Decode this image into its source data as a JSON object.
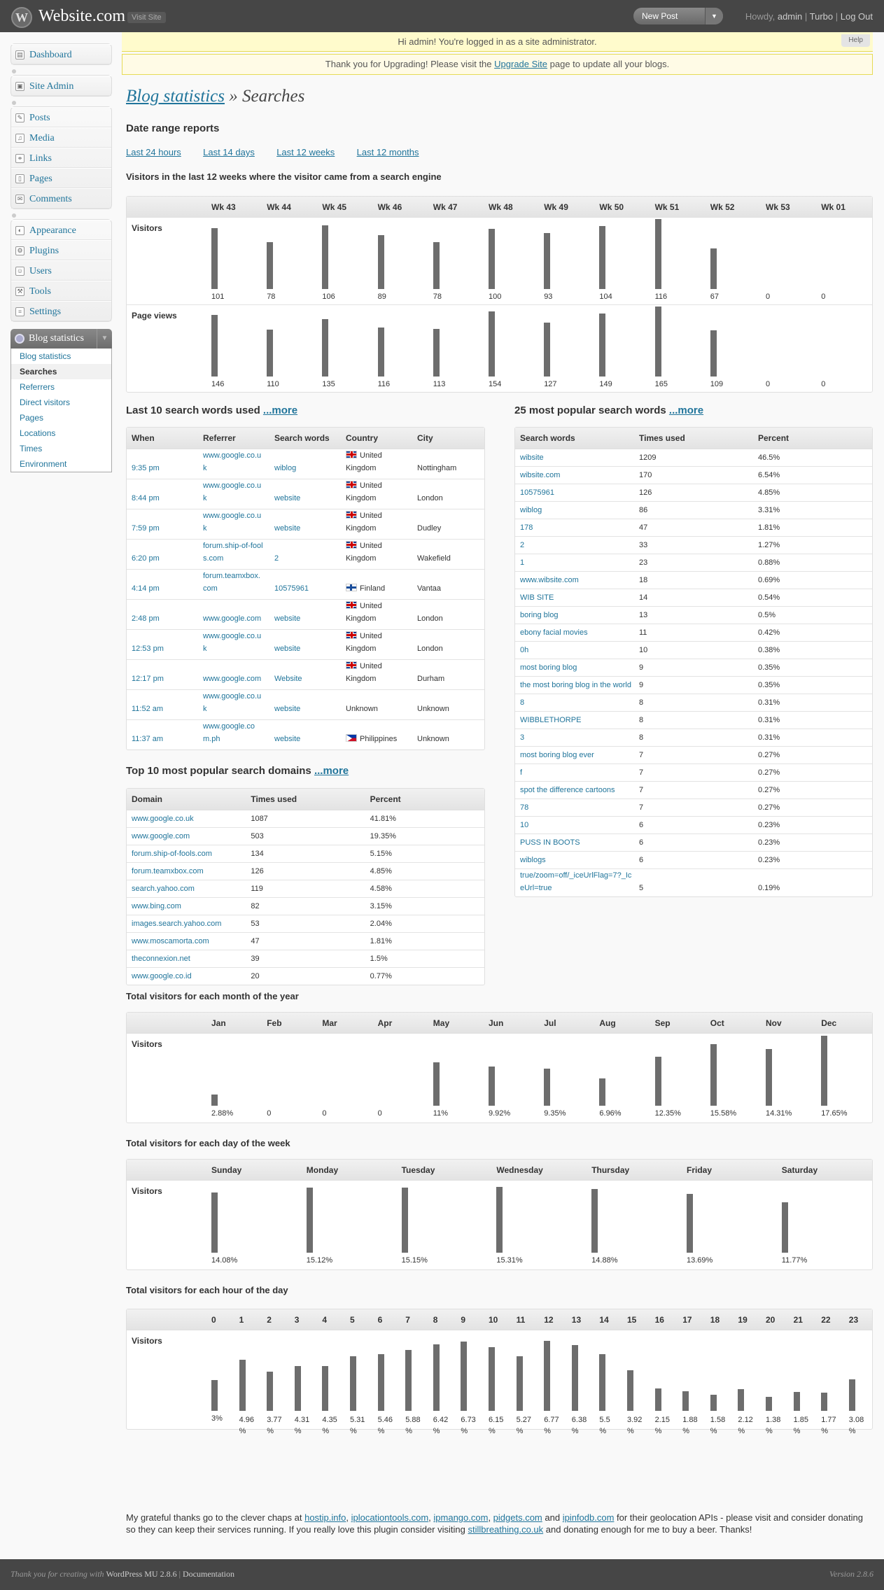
{
  "header": {
    "site_title": "Website.com",
    "visit_site": "Visit Site",
    "new_post": "New Post",
    "howdy": "Howdy,",
    "user": "admin",
    "turbo": "Turbo",
    "logout": "Log Out"
  },
  "notices": {
    "admin_notice": "Hi admin! You're logged in as a site administrator.",
    "help": "Help",
    "upgrade_pre": "Thank you for Upgrading! Please visit the ",
    "upgrade_link": "Upgrade Site",
    "upgrade_post": " page to update all your blogs."
  },
  "sidebar": {
    "group1": [
      "Dashboard"
    ],
    "group2": [
      "Site Admin"
    ],
    "group3": [
      "Posts",
      "Media",
      "Links",
      "Pages",
      "Comments"
    ],
    "group4": [
      "Appearance",
      "Plugins",
      "Users",
      "Tools",
      "Settings"
    ],
    "stats_head": "Blog statistics",
    "stats_items": [
      "Blog statistics",
      "Searches",
      "Referrers",
      "Direct visitors",
      "Pages",
      "Locations",
      "Times",
      "Environment"
    ],
    "stats_current": "Searches"
  },
  "page": {
    "title_link": "Blog statistics",
    "title_rest": " » Searches",
    "date_range_heading": "Date range reports",
    "ranges": [
      "Last 24 hours",
      "Last 14 days",
      "Last 12 weeks",
      "Last 12 months"
    ],
    "weekly_heading": "Visitors in the last 12 weeks where the visitor came from a search engine",
    "more": "...more"
  },
  "weekly": {
    "weeks": [
      "Wk 43",
      "Wk 44",
      "Wk 45",
      "Wk 46",
      "Wk 47",
      "Wk 48",
      "Wk 49",
      "Wk 50",
      "Wk 51",
      "Wk 52",
      "Wk 53",
      "Wk 01"
    ],
    "rows": [
      {
        "label": "Visitors",
        "values": [
          101,
          78,
          106,
          89,
          78,
          100,
          93,
          104,
          116,
          67,
          0,
          0
        ]
      },
      {
        "label": "Page views",
        "values": [
          146,
          110,
          135,
          116,
          113,
          154,
          127,
          149,
          165,
          109,
          0,
          0
        ]
      }
    ]
  },
  "last10": {
    "heading": "Last 10 search words used",
    "columns": [
      "When",
      "Referrer",
      "Search words",
      "Country",
      "City"
    ],
    "rows": [
      {
        "when": "9:35 pm",
        "ref": "www.google.co.uk",
        "words": "wiblog",
        "flag": "uk",
        "country": "United Kingdom",
        "city": "Nottingham"
      },
      {
        "when": "8:44 pm",
        "ref": "www.google.co.uk",
        "words": "website",
        "flag": "uk",
        "country": "United Kingdom",
        "city": "London"
      },
      {
        "when": "7:59 pm",
        "ref": "www.google.co.uk",
        "words": "website",
        "flag": "uk",
        "country": "United Kingdom",
        "city": "Dudley"
      },
      {
        "when": "6:20 pm",
        "ref": "forum.ship-of-fools.com",
        "words": "2",
        "flag": "uk",
        "country": "United Kingdom",
        "city": "Wakefield"
      },
      {
        "when": "4:14 pm",
        "ref": "forum.teamxbox.com",
        "words": "10575961",
        "flag": "fi",
        "country": "Finland",
        "city": "Vantaa"
      },
      {
        "when": "2:48 pm",
        "ref": "www.google.com",
        "words": "website",
        "flag": "uk",
        "country": "United Kingdom",
        "city": "London"
      },
      {
        "when": "12:53 pm",
        "ref": "www.google.co.uk",
        "words": "website",
        "flag": "uk",
        "country": "United Kingdom",
        "city": "London"
      },
      {
        "when": "12:17 pm",
        "ref": "www.google.com",
        "words": "Website",
        "flag": "uk",
        "country": "United Kingdom",
        "city": "Durham"
      },
      {
        "when": "11:52 am",
        "ref": "www.google.co.uk",
        "words": "website",
        "flag": "",
        "country": "Unknown",
        "city": "Unknown"
      },
      {
        "when": "11:37 am",
        "ref": "www.google.com.ph",
        "words": "website",
        "flag": "ph",
        "country": "Philippines",
        "city": "Unknown"
      }
    ]
  },
  "popular_words": {
    "heading": "25 most popular search words",
    "columns": [
      "Search words",
      "Times used",
      "Percent"
    ],
    "rows": [
      {
        "w": "wibsite",
        "t": "1209",
        "p": "46.5%"
      },
      {
        "w": "wibsite.com",
        "t": "170",
        "p": "6.54%"
      },
      {
        "w": "10575961",
        "t": "126",
        "p": "4.85%"
      },
      {
        "w": "wiblog",
        "t": "86",
        "p": "3.31%"
      },
      {
        "w": "178",
        "t": "47",
        "p": "1.81%"
      },
      {
        "w": "2",
        "t": "33",
        "p": "1.27%"
      },
      {
        "w": "1",
        "t": "23",
        "p": "0.88%"
      },
      {
        "w": "www.wibsite.com",
        "t": "18",
        "p": "0.69%"
      },
      {
        "w": "WIB SITE",
        "t": "14",
        "p": "0.54%"
      },
      {
        "w": "boring blog",
        "t": "13",
        "p": "0.5%"
      },
      {
        "w": "ebony facial movies",
        "t": "11",
        "p": "0.42%"
      },
      {
        "w": "0h",
        "t": "10",
        "p": "0.38%"
      },
      {
        "w": "most boring blog",
        "t": "9",
        "p": "0.35%"
      },
      {
        "w": "the most boring blog in the world",
        "t": "9",
        "p": "0.35%"
      },
      {
        "w": "8",
        "t": "8",
        "p": "0.31%"
      },
      {
        "w": "WIBBLETHORPE",
        "t": "8",
        "p": "0.31%"
      },
      {
        "w": "3",
        "t": "8",
        "p": "0.31%"
      },
      {
        "w": "most boring blog ever",
        "t": "7",
        "p": "0.27%"
      },
      {
        "w": "f",
        "t": "7",
        "p": "0.27%"
      },
      {
        "w": "spot the difference cartoons",
        "t": "7",
        "p": "0.27%"
      },
      {
        "w": "78",
        "t": "7",
        "p": "0.27%"
      },
      {
        "w": "10",
        "t": "6",
        "p": "0.23%"
      },
      {
        "w": "PUSS IN BOOTS",
        "t": "6",
        "p": "0.23%"
      },
      {
        "w": "wiblogs",
        "t": "6",
        "p": "0.23%"
      },
      {
        "w": "true/zoom=off/_iceUrlFlag=7?_IceUrl=true",
        "t": "5",
        "p": "0.19%"
      }
    ]
  },
  "domains": {
    "heading": "Top 10 most popular search domains",
    "columns": [
      "Domain",
      "Times used",
      "Percent"
    ],
    "rows": [
      {
        "d": "www.google.co.uk",
        "t": "1087",
        "p": "41.81%"
      },
      {
        "d": "www.google.com",
        "t": "503",
        "p": "19.35%"
      },
      {
        "d": "forum.ship-of-fools.com",
        "t": "134",
        "p": "5.15%"
      },
      {
        "d": "forum.teamxbox.com",
        "t": "126",
        "p": "4.85%"
      },
      {
        "d": "search.yahoo.com",
        "t": "119",
        "p": "4.58%"
      },
      {
        "d": "www.bing.com",
        "t": "82",
        "p": "3.15%"
      },
      {
        "d": "images.search.yahoo.com",
        "t": "53",
        "p": "2.04%"
      },
      {
        "d": "www.moscamorta.com",
        "t": "47",
        "p": "1.81%"
      },
      {
        "d": "theconnexion.net",
        "t": "39",
        "p": "1.5%"
      },
      {
        "d": "www.google.co.id",
        "t": "20",
        "p": "0.77%"
      }
    ]
  },
  "monthly": {
    "heading": "Total visitors for each month of the year",
    "row_label": "Visitors",
    "months": [
      "Jan",
      "Feb",
      "Mar",
      "Apr",
      "May",
      "Jun",
      "Jul",
      "Aug",
      "Sep",
      "Oct",
      "Nov",
      "Dec"
    ],
    "values": [
      2.88,
      0,
      0,
      0,
      11,
      9.92,
      9.35,
      6.96,
      12.35,
      15.58,
      14.31,
      17.65
    ],
    "labels": [
      "2.88%",
      "0",
      "0",
      "0",
      "11%",
      "9.92%",
      "9.35%",
      "6.96%",
      "12.35%",
      "15.58%",
      "14.31%",
      "17.65%"
    ]
  },
  "weekday": {
    "heading": "Total visitors for each day of the week",
    "row_label": "Visitors",
    "days": [
      "Sunday",
      "Monday",
      "Tuesday",
      "Wednesday",
      "Thursday",
      "Friday",
      "Saturday"
    ],
    "values": [
      14.08,
      15.12,
      15.15,
      15.31,
      14.88,
      13.69,
      11.77
    ],
    "labels": [
      "14.08%",
      "15.12%",
      "15.15%",
      "15.31%",
      "14.88%",
      "13.69%",
      "11.77%"
    ]
  },
  "hourly": {
    "heading": "Total visitors for each hour of the day",
    "row_label": "Visitors",
    "hours": [
      "0",
      "1",
      "2",
      "3",
      "4",
      "5",
      "6",
      "7",
      "8",
      "9",
      "10",
      "11",
      "12",
      "13",
      "14",
      "15",
      "16",
      "17",
      "18",
      "19",
      "20",
      "21",
      "22",
      "23"
    ],
    "values": [
      3,
      4.96,
      3.77,
      4.31,
      4.35,
      5.31,
      5.46,
      5.88,
      6.42,
      6.73,
      6.15,
      5.27,
      6.77,
      6.38,
      5.5,
      3.92,
      2.15,
      1.88,
      1.58,
      2.12,
      1.38,
      1.85,
      1.77,
      3.08
    ],
    "labels": [
      "3%",
      "4.96 %",
      "3.77 %",
      "4.31 %",
      "4.35 %",
      "5.31 %",
      "5.46 %",
      "5.88 %",
      "6.42 %",
      "6.73 %",
      "6.15 %",
      "5.27 %",
      "6.77 %",
      "6.38 %",
      "5.5 %",
      "3.92 %",
      "2.15 %",
      "1.88 %",
      "1.58 %",
      "2.12 %",
      "1.38 %",
      "1.85 %",
      "1.77 %",
      "3.08 %"
    ]
  },
  "thanks": {
    "t1": "My grateful thanks go to the clever chaps at ",
    "l1": "hostip.info",
    "s1": ", ",
    "l2": "iplocationtools.com",
    "s2": ", ",
    "l3": "ipmango.com",
    "s3": ", ",
    "l4": "pidgets.com",
    "s4": " and ",
    "l5": "ipinfodb.com",
    "t2": " for their geolocation APIs - please visit and consider donating so they can keep their services running. If you really love this plugin consider visiting ",
    "l6": "stillbreathing.co.uk",
    "t3": " and donating enough for me to buy a beer. Thanks!"
  },
  "footer": {
    "thank_you": "Thank you for creating with ",
    "wp": "WordPress MU 2.8.6",
    "sep": " | ",
    "docs": "Documentation",
    "version": "Version 2.8.6"
  },
  "colors": {
    "bar": "#6d6d6d",
    "link": "#21759b",
    "header_bg": "#464646"
  }
}
